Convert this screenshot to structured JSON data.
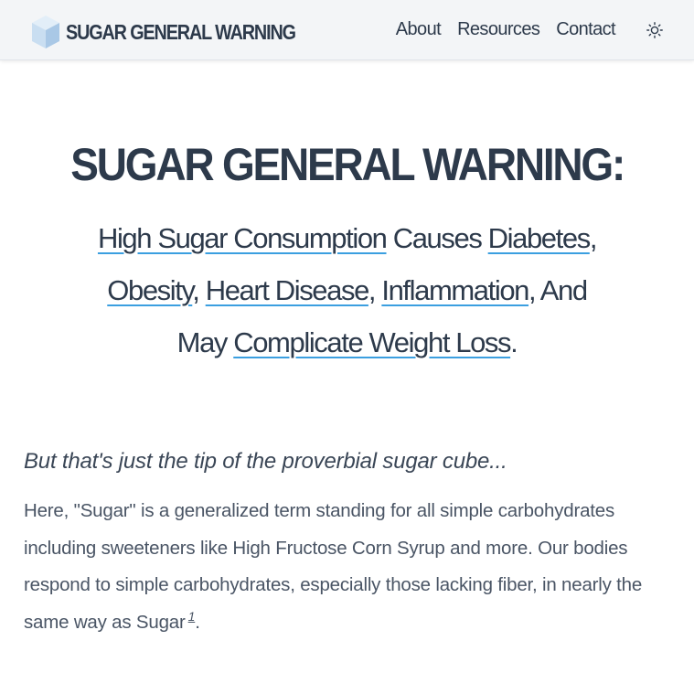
{
  "nav": {
    "brand": "SUGAR GENERAL WARNING",
    "links": [
      "About",
      "Resources",
      "Contact"
    ],
    "theme_icon": "sun-icon"
  },
  "hero": {
    "title": "SUGAR GENERAL WARNING:",
    "subtitle": {
      "link_high_sugar": "High Sugar Consumption",
      "text_causes": " Causes ",
      "link_diabetes": "Diabetes",
      "sep1": ", ",
      "link_obesity": "Obesity",
      "sep2": ", ",
      "link_heart": "Heart Disease",
      "sep3": ", ",
      "link_inflammation": "Inflammation",
      "text_and_may": ", And May ",
      "link_weight_loss": "Complicate Weight Loss",
      "end": "."
    }
  },
  "content": {
    "tagline": "But that's just the tip of the proverbial sugar cube...",
    "body": "Here, \"Sugar\" is a generalized term standing for all simple carbohydrates including sweeteners like High Fructose Corn Syrup and more. Our bodies respond to simple carbohydrates, especially those lacking fiber, in nearly the same way as Sugar",
    "footnote": "1",
    "body_end": "."
  },
  "colors": {
    "text": "#2d3a4b",
    "link_underline": "#3b9fe0",
    "navbar_bg": "#f3f5f7",
    "cube": "#b9d6ef"
  }
}
